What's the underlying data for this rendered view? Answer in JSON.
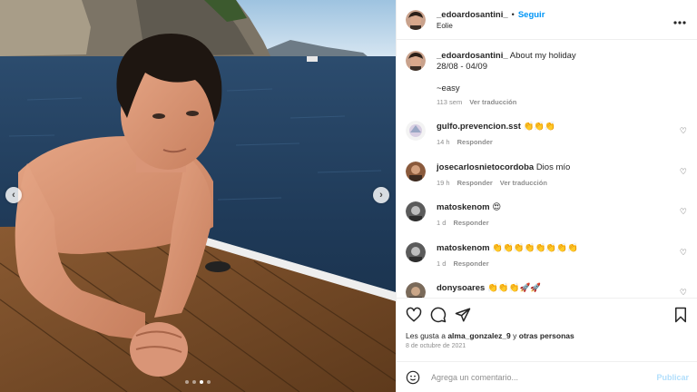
{
  "post": {
    "username": "_edoardosantini_",
    "separator": "•",
    "follow_label": "Seguir",
    "location": "Eolie",
    "more_label": "..."
  },
  "caption": {
    "username": "_edoardosantini_",
    "text": "About my holiday\n28/08 - 04/09\n\n~easy",
    "time": "113 sem",
    "translate": "Ver traducción"
  },
  "comments": [
    {
      "username": "gulfo.prevencion.sst",
      "text": "👏👏👏",
      "time": "14 h",
      "reply": "Responder",
      "translate": ""
    },
    {
      "username": "josecarlosnietocordoba",
      "text": "Dios mío",
      "time": "19 h",
      "reply": "Responder",
      "translate": "Ver traducción"
    },
    {
      "username": "matoskenom",
      "text": "😍",
      "time": "1 d",
      "reply": "Responder",
      "translate": ""
    },
    {
      "username": "matoskenom",
      "text": "👏👏👏👏👏👏👏👏",
      "time": "1 d",
      "reply": "Responder",
      "translate": ""
    },
    {
      "username": "donysoares",
      "text": "👏👏👏🚀🚀",
      "time": "",
      "reply": "",
      "translate": ""
    }
  ],
  "likes": {
    "prefix": "Les gusta a",
    "user": "alma_gonzalez_9",
    "middle": "y",
    "others": "otras personas"
  },
  "post_date": "8 de octubre de 2021",
  "comment_box": {
    "placeholder": "Agrega un comentario...",
    "publish": "Publicar"
  },
  "carousel": {
    "count": 4,
    "active": 2
  },
  "colors": {
    "accent": "#0095f6",
    "publish_disabled": "#b2dffc",
    "muted": "#8e8e8e"
  },
  "icons": [
    "heart-icon",
    "comment-icon",
    "share-icon",
    "bookmark-icon",
    "emoji-icon",
    "more-icon"
  ]
}
